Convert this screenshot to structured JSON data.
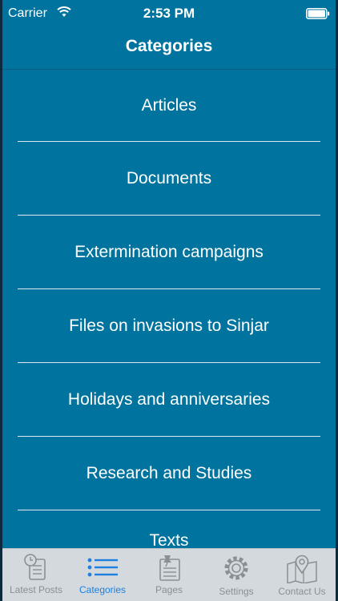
{
  "status_bar": {
    "carrier": "Carrier",
    "time": "2:53 PM"
  },
  "nav": {
    "title": "Categories"
  },
  "categories": [
    "Articles",
    "Documents",
    "Extermination campaigns",
    "Files on invasions to Sinjar",
    "Holidays and anniversaries",
    "Research and Studies",
    "Texts"
  ],
  "tabs": [
    {
      "label": "Latest Posts",
      "icon": "latest-posts-icon",
      "active": false
    },
    {
      "label": "Categories",
      "icon": "list-icon",
      "active": true
    },
    {
      "label": "Pages",
      "icon": "pages-icon",
      "active": false
    },
    {
      "label": "Settings",
      "icon": "gear-icon",
      "active": false
    },
    {
      "label": "Contact Us",
      "icon": "map-pin-icon",
      "active": false
    }
  ],
  "colors": {
    "background": "#00749e",
    "tab_bar": "#d3d9dc",
    "active_tab": "#1f7fe0",
    "inactive_tab": "#8a8f93"
  }
}
